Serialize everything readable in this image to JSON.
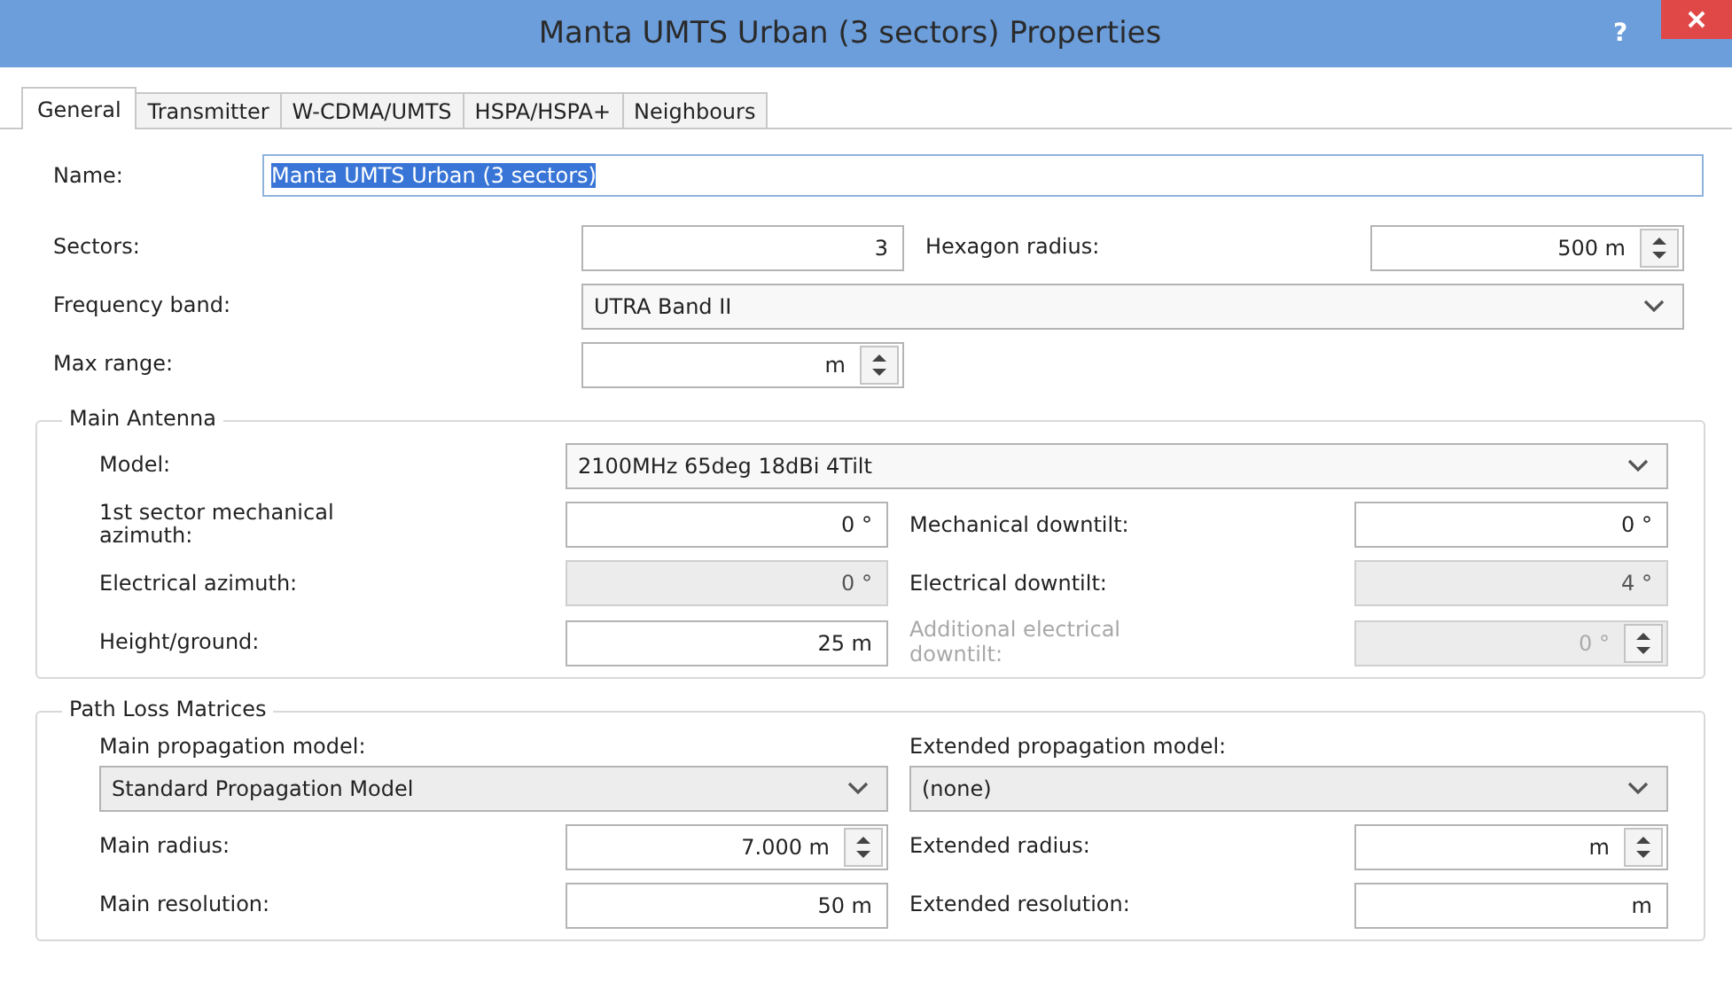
{
  "window": {
    "title": "Manta UMTS Urban (3 sectors) Properties",
    "help": "?"
  },
  "tabs": [
    {
      "label": "General",
      "selected": true
    },
    {
      "label": "Transmitter",
      "selected": false
    },
    {
      "label": "W-CDMA/UMTS",
      "selected": false
    },
    {
      "label": "HSPA/HSPA+",
      "selected": false
    },
    {
      "label": "Neighbours",
      "selected": false
    }
  ],
  "name": {
    "label": "Name:",
    "value": "Manta UMTS Urban (3 sectors)",
    "highlighted": true
  },
  "sections": [
    {
      "rows": [
        {
          "kind": "pair",
          "items": [
            {
              "label": "Sectors:",
              "dimmed": false,
              "field": {
                "kind": "number",
                "value": "3",
                "spinner": false,
                "disabled": false
              }
            },
            {
              "label": "Hexagon radius:",
              "dimmed": false,
              "field": {
                "kind": "number",
                "value": "500 m",
                "spinner": true,
                "disabled": false
              }
            }
          ]
        },
        {
          "kind": "single",
          "items": [
            {
              "label": "Frequency band:",
              "dimmed": false,
              "field": {
                "kind": "select",
                "value": "UTRA Band II",
                "disabled": false
              }
            }
          ]
        },
        {
          "kind": "single",
          "items": [
            {
              "label": "Max range:",
              "dimmed": false,
              "field": {
                "kind": "number",
                "value": "m",
                "spinner": true,
                "disabled": false
              }
            }
          ]
        }
      ]
    },
    {
      "legend": "Main Antenna",
      "rows": [
        {
          "kind": "single",
          "items": [
            {
              "label": "Model:",
              "dimmed": false,
              "field": {
                "kind": "select",
                "value": "2100MHz 65deg 18dBi 4Tilt",
                "disabled": false
              }
            }
          ]
        },
        {
          "kind": "pair",
          "items": [
            {
              "label": "1st sector mechanical azimuth:",
              "dimmed": false,
              "field": {
                "kind": "number",
                "value": "0 °",
                "spinner": false,
                "disabled": false
              }
            },
            {
              "label": "Mechanical downtilt:",
              "dimmed": false,
              "field": {
                "kind": "number",
                "value": "0 °",
                "spinner": false,
                "disabled": false
              }
            }
          ]
        },
        {
          "kind": "pair",
          "items": [
            {
              "label": "Electrical azimuth:",
              "dimmed": false,
              "field": {
                "kind": "number",
                "value": "0 °",
                "spinner": false,
                "disabled": true
              }
            },
            {
              "label": "Electrical downtilt:",
              "dimmed": false,
              "field": {
                "kind": "number",
                "value": "4 °",
                "spinner": false,
                "disabled": true
              }
            }
          ]
        },
        {
          "kind": "pair",
          "items": [
            {
              "label": "Height/ground:",
              "dimmed": false,
              "field": {
                "kind": "number",
                "value": "25 m",
                "spinner": false,
                "disabled": false
              }
            },
            {
              "label": "Additional electrical downtilt:",
              "dimmed": true,
              "field": {
                "kind": "number",
                "value": "0 °",
                "spinner": true,
                "disabled": true
              }
            }
          ]
        }
      ]
    },
    {
      "legend": "Path Loss Matrices",
      "rows": [
        {
          "kind": "stacked",
          "items": [
            {
              "label": "Main propagation model:",
              "dimmed": false,
              "field": {
                "kind": "select",
                "value": "Standard Propagation Model",
                "disabled": false
              }
            },
            {
              "label": "Extended propagation model:",
              "dimmed": false,
              "field": {
                "kind": "select",
                "value": "(none)",
                "disabled": false
              }
            }
          ]
        },
        {
          "kind": "pair",
          "items": [
            {
              "label": "Main radius:",
              "dimmed": false,
              "field": {
                "kind": "number",
                "value": "7.000 m",
                "spinner": true,
                "disabled": false
              }
            },
            {
              "label": "Extended radius:",
              "dimmed": false,
              "field": {
                "kind": "number",
                "value": "m",
                "spinner": true,
                "disabled": false
              }
            }
          ]
        },
        {
          "kind": "pair",
          "items": [
            {
              "label": "Main resolution:",
              "dimmed": false,
              "field": {
                "kind": "number",
                "value": "50 m",
                "spinner": false,
                "disabled": false
              }
            },
            {
              "label": "Extended resolution:",
              "dimmed": false,
              "field": {
                "kind": "number",
                "value": "m",
                "spinner": false,
                "disabled": false
              }
            }
          ]
        }
      ]
    }
  ]
}
